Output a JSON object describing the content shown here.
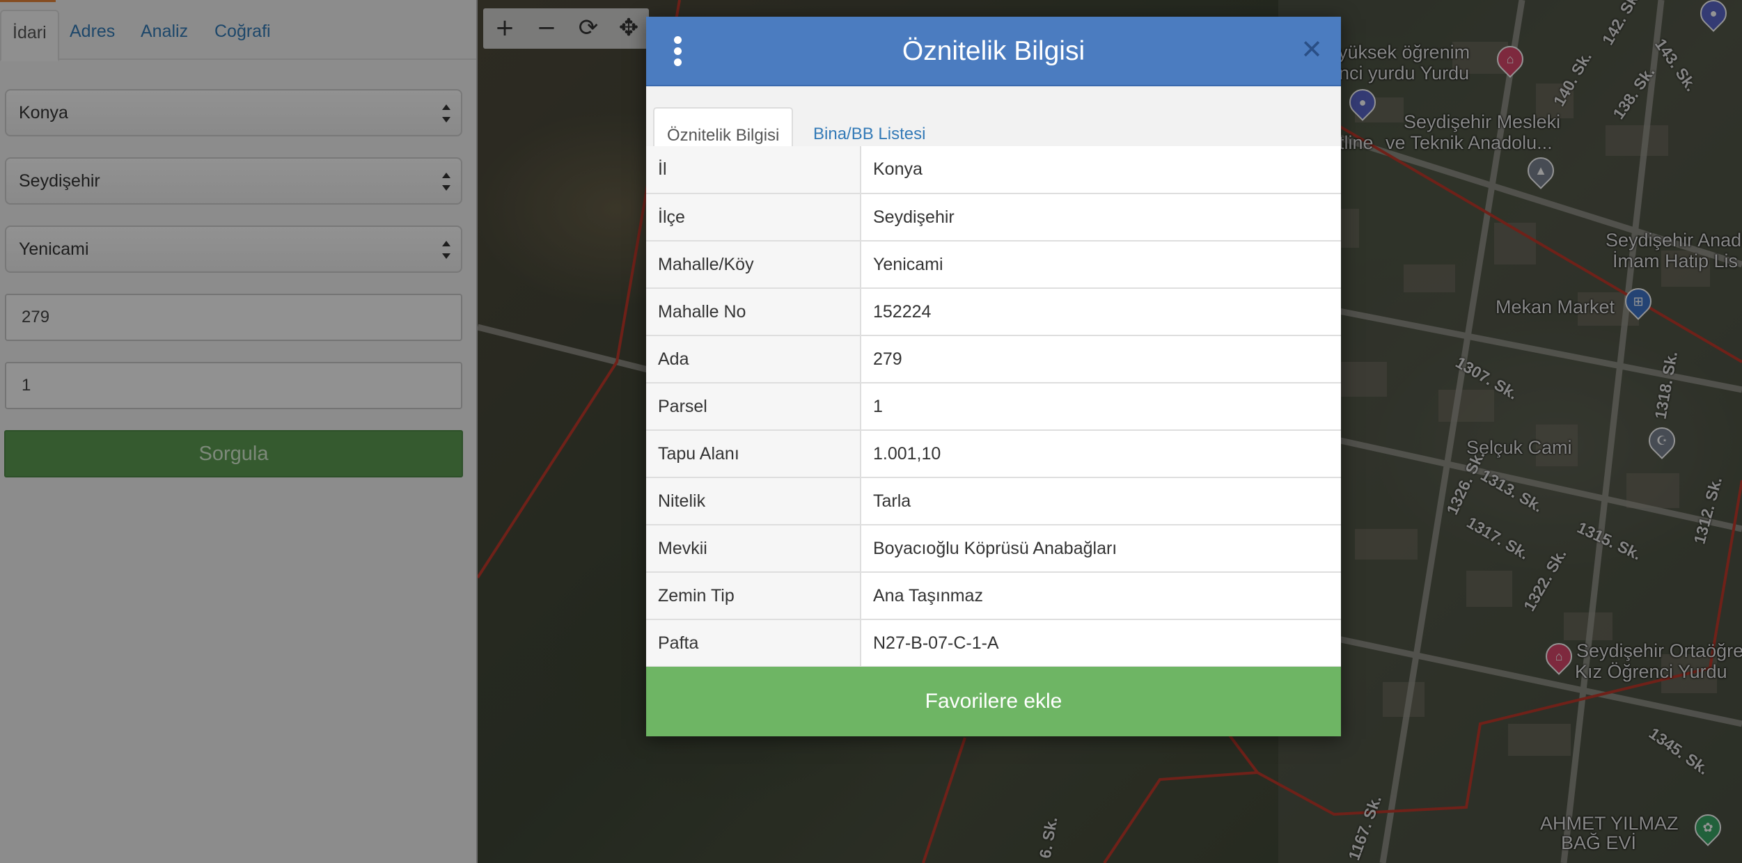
{
  "left_panel": {
    "tabs": [
      {
        "label": "İdari"
      },
      {
        "label": "Adres"
      },
      {
        "label": "Analiz"
      },
      {
        "label": "Coğrafi"
      }
    ],
    "province_select": {
      "value": "Konya"
    },
    "district_select": {
      "value": "Seydişehir"
    },
    "neighborhood_select": {
      "value": "Yenicami"
    },
    "block_input": {
      "value": "279"
    },
    "parcel_input": {
      "value": "1"
    },
    "submit_label": "Sorgula"
  },
  "map": {
    "toolbar": {
      "zoom_in": "+",
      "zoom_out": "−",
      "refresh": "⟳",
      "locate": "✥"
    },
    "places": [
      {
        "label": "yüksek öğrenim"
      },
      {
        "label": "enci yurdu Yurdu"
      },
      {
        "label": "Seydişehir Mesleki"
      },
      {
        "label": "ve Teknik Anadolu..."
      },
      {
        "label": "etline"
      },
      {
        "label": "Seydişehir Anad"
      },
      {
        "label": "İmam Hatip Lis"
      },
      {
        "label": "Mekan Market"
      },
      {
        "label": "Selçuk Cami"
      },
      {
        "label": "Seydişehir Ortaöğre"
      },
      {
        "label": "Kız Öğrenci Yurdu"
      },
      {
        "label": "AHMET YILMAZ"
      },
      {
        "label": "BAĞ EVİ"
      }
    ],
    "streets": [
      {
        "label": "142. Sk."
      },
      {
        "label": "143. Sk."
      },
      {
        "label": "140. Sk."
      },
      {
        "label": "138. Sk."
      },
      {
        "label": "1307. Sk."
      },
      {
        "label": "1318. Sk."
      },
      {
        "label": "1326. Sk."
      },
      {
        "label": "1313. Sk."
      },
      {
        "label": "1317. Sk."
      },
      {
        "label": "1315. Sk."
      },
      {
        "label": "1322. Sk."
      },
      {
        "label": "1312. Sk."
      },
      {
        "label": "1345. Sk."
      },
      {
        "label": "1167. Sk."
      },
      {
        "label": "6. Sk."
      }
    ]
  },
  "modal": {
    "title": "Öznitelik Bilgisi",
    "close_symbol": "✕",
    "tabs": [
      {
        "label": "Öznitelik Bilgisi"
      },
      {
        "label": "Bina/BB Listesi"
      }
    ],
    "rows": [
      {
        "key": "İl",
        "value": "Konya"
      },
      {
        "key": "İlçe",
        "value": "Seydişehir"
      },
      {
        "key": "Mahalle/Köy",
        "value": "Yenicami"
      },
      {
        "key": "Mahalle No",
        "value": "152224"
      },
      {
        "key": "Ada",
        "value": "279"
      },
      {
        "key": "Parsel",
        "value": "1"
      },
      {
        "key": "Tapu Alanı",
        "value": "1.001,10"
      },
      {
        "key": "Nitelik",
        "value": "Tarla"
      },
      {
        "key": "Mevkii",
        "value": "Boyacıoğlu Köprüsü Anabağları"
      },
      {
        "key": "Zemin Tip",
        "value": "Ana Taşınmaz"
      },
      {
        "key": "Pafta",
        "value": "N27-B-07-C-1-A"
      }
    ],
    "favorite_label": "Favorilere ekle"
  },
  "colors": {
    "header_blue": "#4b7cc0",
    "action_green": "#6eb564",
    "submit_green": "#5c9c52",
    "link_blue": "#337ab7",
    "boundary_red": "#c0392b"
  }
}
